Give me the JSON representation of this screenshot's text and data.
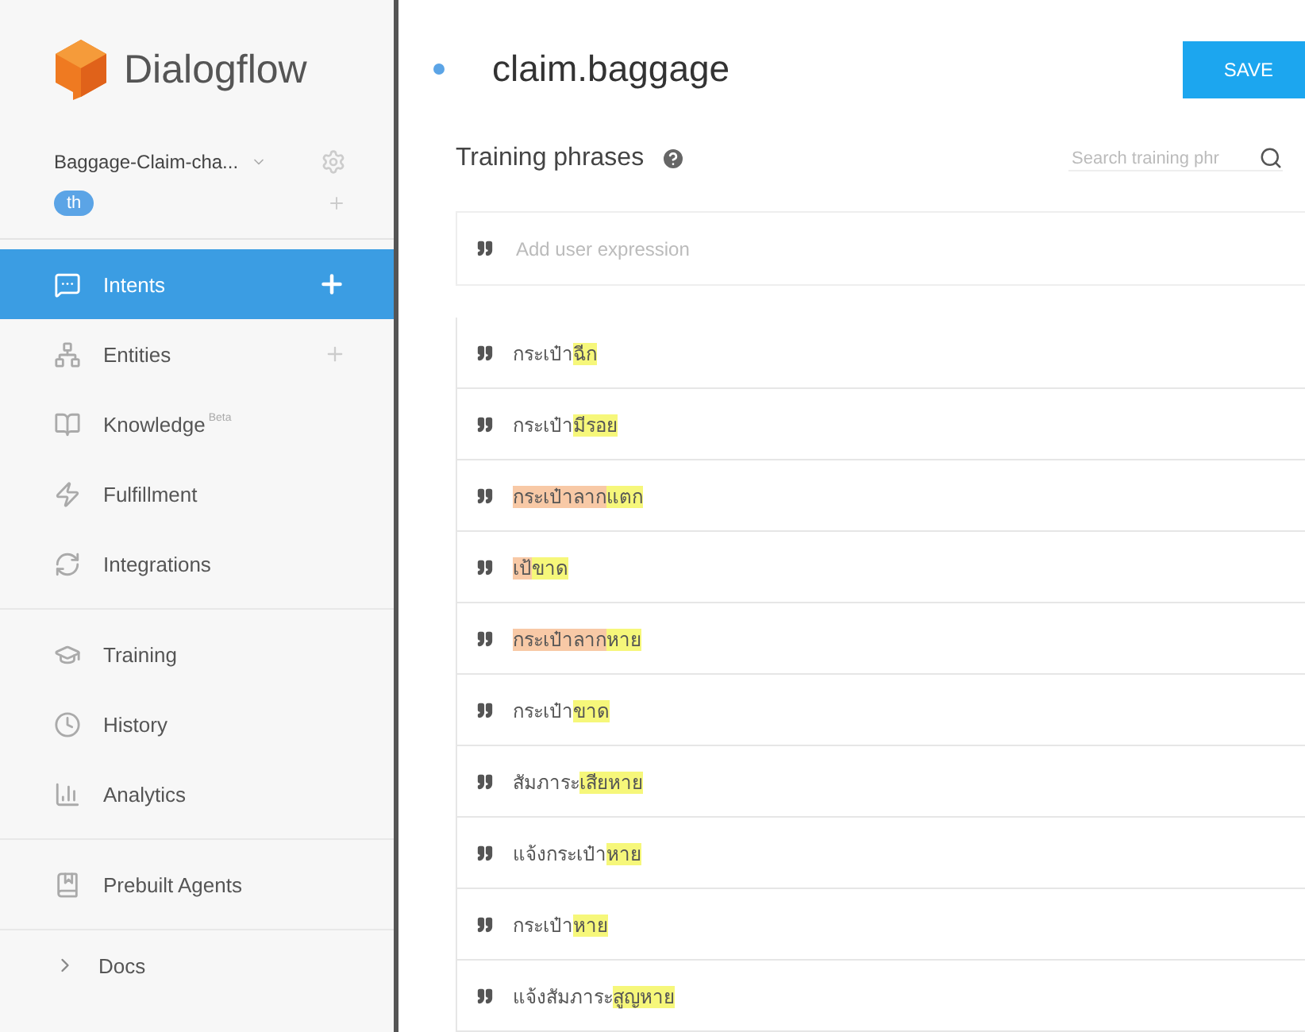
{
  "brand": {
    "name": "Dialogflow"
  },
  "agent": {
    "name": "Baggage-Claim-cha...",
    "language": "th"
  },
  "nav_groups": [
    [
      {
        "label": "Intents",
        "selected": true,
        "add": true
      },
      {
        "label": "Entities",
        "selected": false,
        "add": true
      },
      {
        "label": "Knowledge",
        "selected": false,
        "add": false,
        "badge": "Beta"
      },
      {
        "label": "Fulfillment",
        "selected": false,
        "add": false
      },
      {
        "label": "Integrations",
        "selected": false,
        "add": false
      }
    ],
    [
      {
        "label": "Training",
        "selected": false,
        "add": false
      },
      {
        "label": "History",
        "selected": false,
        "add": false
      },
      {
        "label": "Analytics",
        "selected": false,
        "add": false
      }
    ],
    [
      {
        "label": "Prebuilt Agents",
        "selected": false,
        "add": false
      }
    ]
  ],
  "docs": {
    "label": "Docs"
  },
  "intent": {
    "title": "claim.baggage",
    "save_label": "SAVE"
  },
  "training": {
    "title": "Training phrases",
    "search_placeholder": "Search training phr",
    "add_placeholder": "Add user expression",
    "phrases": [
      [
        {
          "text": "กระเป๋า"
        },
        {
          "text": "ฉีก",
          "color": "#f6f77a"
        }
      ],
      [
        {
          "text": "กระเป๋า"
        },
        {
          "text": "มีรอย",
          "color": "#f6f77a"
        }
      ],
      [
        {
          "text": "กระเป๋าลาก",
          "color": "#f8c9a6"
        },
        {
          "text": "แตก",
          "color": "#f6f77a"
        }
      ],
      [
        {
          "text": "เป้",
          "color": "#f8c9a6"
        },
        {
          "text": "ขาด",
          "color": "#f6f77a"
        }
      ],
      [
        {
          "text": "กระเป๋าลาก",
          "color": "#f8c9a6"
        },
        {
          "text": "หาย",
          "color": "#f6f77a"
        }
      ],
      [
        {
          "text": "กระเป๋า"
        },
        {
          "text": "ขาด",
          "color": "#f6f77a"
        }
      ],
      [
        {
          "text": "สัมภาระ"
        },
        {
          "text": "เสียหาย",
          "color": "#f6f77a"
        }
      ],
      [
        {
          "text": "แจ้งกระเป๋า"
        },
        {
          "text": "หาย",
          "color": "#f6f77a"
        }
      ],
      [
        {
          "text": "กระเป๋า"
        },
        {
          "text": "หาย",
          "color": "#f6f77a"
        }
      ],
      [
        {
          "text": "แจ้งสัมภาระ"
        },
        {
          "text": "สูญหาย",
          "color": "#f6f77a"
        }
      ]
    ]
  }
}
